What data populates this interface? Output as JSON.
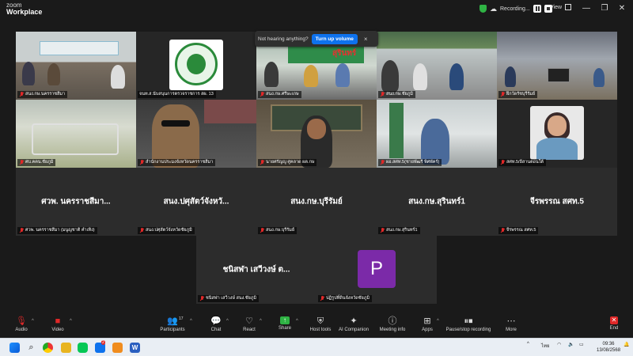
{
  "app": {
    "logo_line1": "zoom",
    "logo_line2": "Workplace"
  },
  "titlebar": {
    "recording_label": "Recording...",
    "view_label": "View"
  },
  "notification": {
    "text": "Not hearing anything?",
    "button": "Turn up volume",
    "close": "×"
  },
  "tiles": [
    {
      "name": "สนง.กษ.นครราชสีมา"
    },
    {
      "name": "จนท.ส.นับสนุนการตรวจราชการ สผ. 13"
    },
    {
      "name": "สนง.กษ.ศรีษะเกษ"
    },
    {
      "name": "สนง.กษ.ชัยภูมิ"
    },
    {
      "name": "ฝึกวัดรัชบุรีรัมย์"
    },
    {
      "name": "ศบ.คคน.ชัยภูมิ"
    },
    {
      "name": "สำนักงานประมงจังหวัดนครราชสีมา"
    },
    {
      "name": "นายศรัญญู ศูคลาด ผต.กษ"
    },
    {
      "name": "ผอ.สศท.5(ชายพัฒรี พิศพัคร์)"
    },
    {
      "name": "สศท.5/อีสานตอนใต้"
    }
  ],
  "name_tiles": [
    {
      "display": "ศวพ. นครราชสีมา...",
      "name": "ศวพ. นครราชสีมา (มนูญชาติ คำเทิง)"
    },
    {
      "display": "สนง.ปศุสัตว์จังหวั...",
      "name": "สนง.ปศุสัตว์จังหวัดชัยภูมิ"
    },
    {
      "display": "สนง.กษ.บุรีรัมย์",
      "name": "สนง.กษ.บุรีรัมย์"
    },
    {
      "display": "สนง.กษ.สุรินทร์1",
      "name": "สนง.กษ.สุรินทร์1"
    },
    {
      "display": "จีรพรรณ สศท.5",
      "name": "จีรพรรณ สศท.5"
    },
    {
      "display": "ชนิสฬา เสวีวงษ์ ต...",
      "name": "ชนิสฬา เสวีวงษ์ สนง.ชัยภูมิ"
    },
    {
      "display": "",
      "name": "ปฏิรูปที่ดินจังหวัดชัยภูมิ",
      "avatar": "P"
    }
  ],
  "banner_text": "สุรินทร์",
  "toolbar": {
    "audio": "Audio",
    "video": "Video",
    "participants": "Participants",
    "participants_count": "17",
    "chat": "Chat",
    "react": "React",
    "share": "Share",
    "host_tools": "Host tools",
    "ai_companion": "AI Companion",
    "meeting_info": "Meeting info",
    "apps": "Apps",
    "pause_stop": "Pause/stop recording",
    "more": "More",
    "end": "End"
  },
  "taskbar": {
    "lang": "ไทย",
    "time": "09:36",
    "date": "13/08/2568",
    "zoom_badge": "2"
  },
  "colors": {
    "active_border": "#2fd57a",
    "muted_red": "#e02828",
    "primary_blue": "#0e72ed",
    "avatar_purple": "#7b2aa8"
  }
}
